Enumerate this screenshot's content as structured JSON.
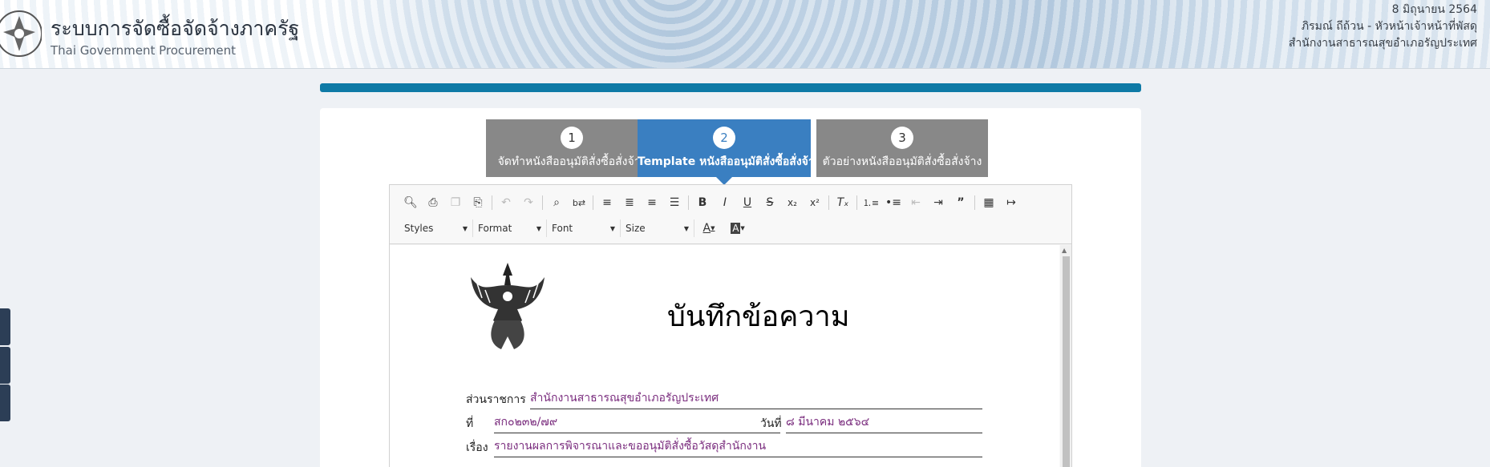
{
  "header": {
    "title": "ระบบการจัดซื้อจัดจ้างภาครัฐ",
    "subtitle": "Thai Government Procurement",
    "date": "8 มิถุนายน 2564",
    "user": "ภิรมณ์ ถีถ้วน - หัวหน้าเจ้าหน้าที่พัสดุ",
    "org": "สำนักงานสาธารณสุขอำเภอรัญประเทศ"
  },
  "steps": [
    {
      "num": "1",
      "label": "จัดทำหนังสืออนุมัติสั่งซื้อสั่งจ้าง"
    },
    {
      "num": "2",
      "label": "Template หนังสืออนุมัติสั่งซื้อสั่งจ้าง"
    },
    {
      "num": "3",
      "label": "ตัวอย่างหนังสืออนุมัติสั่งซื้อสั่งจ้าง"
    }
  ],
  "toolbar": {
    "row1_icons": [
      "preview-icon",
      "print-icon",
      "copy-icon",
      "paste-icon",
      "undo-icon",
      "redo-icon",
      "find-icon",
      "replace-icon",
      "align-left-icon",
      "align-center-icon",
      "align-right-icon",
      "justify-icon",
      "bold-icon",
      "italic-icon",
      "underline-icon",
      "strike-icon",
      "subscript-icon",
      "superscript-icon",
      "remove-format-icon",
      "numbered-list-icon",
      "bulleted-list-icon",
      "outdent-icon",
      "indent-icon",
      "blockquote-icon",
      "table-icon",
      "indent-block-icon"
    ],
    "styles": "Styles",
    "format": "Format",
    "font": "Font",
    "size": "Size"
  },
  "document": {
    "title": "บันทึกข้อความ",
    "agency_label": "ส่วนราชการ",
    "agency_value": "สำนักงานสาธารณสุขอำเภอรัญประเทศ",
    "ref_label": "ที่",
    "ref_value": "สก๐๒๓๒/๗๙",
    "date_label": "วันที่",
    "date_value": "๘ มีนาคม ๒๕๖๔",
    "subject_label": "เรื่อง",
    "subject_value": "รายงานผลการพิจารณาและขออนุมัติสั่งซื้อวัสดุสำนักงาน"
  }
}
